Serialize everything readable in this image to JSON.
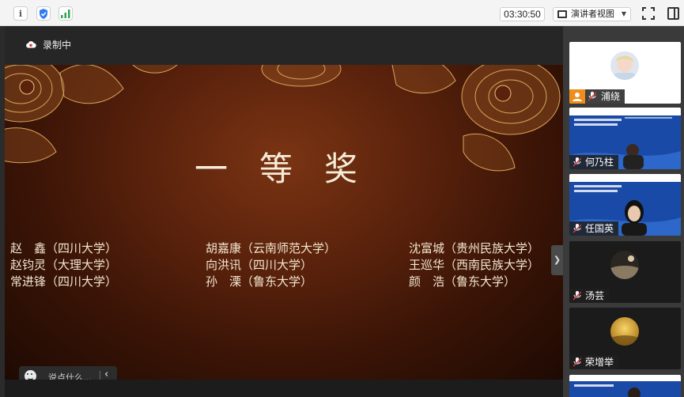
{
  "toolbar": {
    "timer": "03:30:50",
    "presenter_view": "演讲者视图"
  },
  "stage": {
    "recording_label": "录制中",
    "slide": {
      "title": "一等奖",
      "winners": [
        [
          "赵　鑫（四川大学）",
          "赵钧灵（大理大学）",
          "常进锋（四川大学）"
        ],
        [
          "胡嘉康（云南师范大学）",
          "向洪讯（四川大学）",
          "孙　溧（鲁东大学）"
        ],
        [
          "沈富城（贵州民族大学）",
          "王巡华（西南民族大学）",
          "颜　浩（鲁东大学）"
        ]
      ]
    },
    "chat": {
      "placeholder": "说点什么..."
    }
  },
  "participants": [
    {
      "name": "浦绕"
    },
    {
      "name": "何乃柱"
    },
    {
      "name": "任国英"
    },
    {
      "name": "汤芸"
    },
    {
      "name": "荣增举"
    }
  ],
  "colors": {
    "accent_orange": "#f08c1c",
    "video_blue": "#1d4fb0",
    "slide_text": "#f6ecd8"
  }
}
